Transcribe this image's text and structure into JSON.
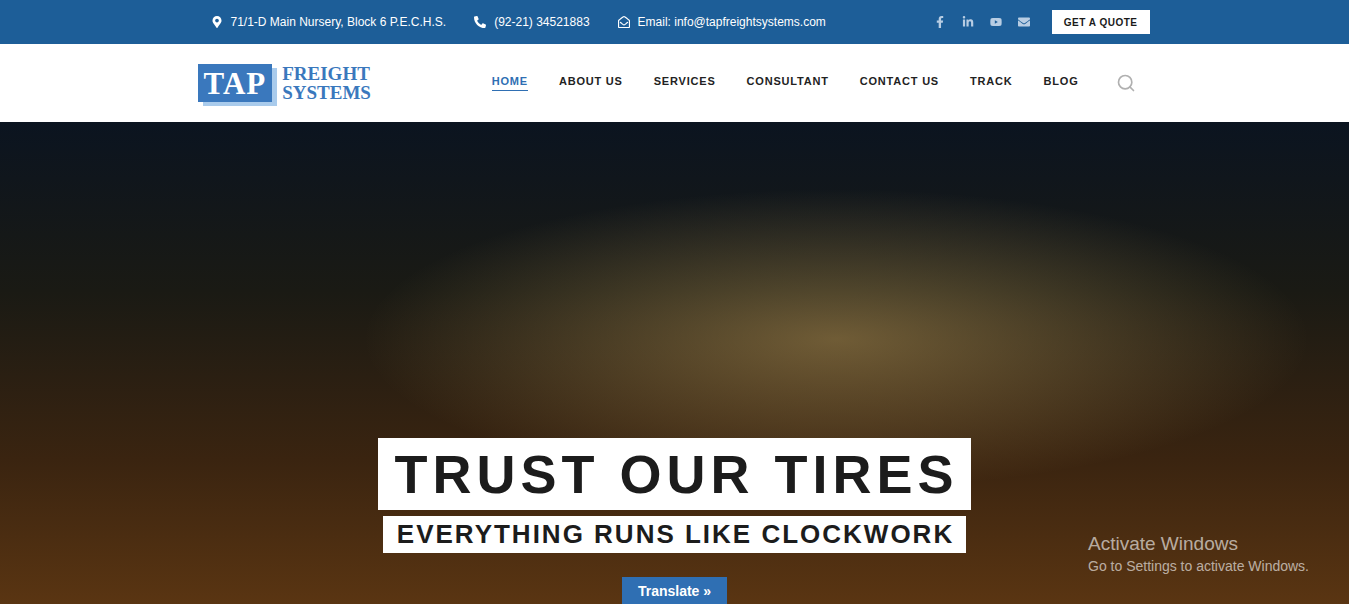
{
  "top_bar": {
    "address": "71/1-D Main Nursery, Block 6 P.E.C.H.S.",
    "phone": "(92-21) 34521883",
    "email": "Email: info@tapfreightsystems.com",
    "quote_button": "GET A QUOTE"
  },
  "logo": {
    "mark": "TAP",
    "line1": "FREIGHT",
    "line2": "SYSTEMS"
  },
  "nav": [
    {
      "label": "HOME",
      "selected": true
    },
    {
      "label": "ABOUT US",
      "selected": false
    },
    {
      "label": "SERVICES",
      "selected": false
    },
    {
      "label": "CONSULTANT",
      "selected": false
    },
    {
      "label": "CONTACT US",
      "selected": false
    },
    {
      "label": "TRACK",
      "selected": false
    },
    {
      "label": "BLOG",
      "selected": false
    }
  ],
  "hero": {
    "title": "TRUST OUR TIRES",
    "subtitle": "EVERYTHING RUNS LIKE CLOCKWORK",
    "translate_button": "Translate »"
  },
  "watermark": {
    "title": "Activate Windows",
    "subtitle": "Go to Settings to activate Windows."
  }
}
